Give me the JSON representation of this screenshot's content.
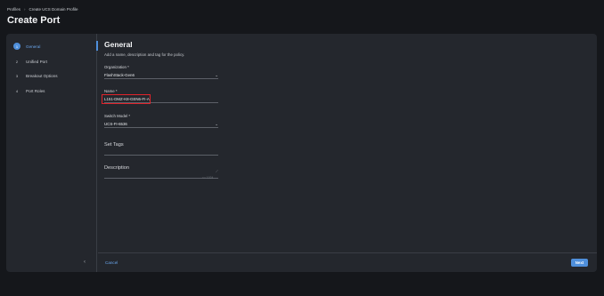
{
  "breadcrumb": {
    "items": [
      "Profiles",
      "Create UCS Domain Profile"
    ],
    "separator": "›"
  },
  "page_title": "Create Port",
  "steps": [
    {
      "num": "1",
      "label": "General",
      "active": true
    },
    {
      "num": "2",
      "label": "Unified Port",
      "active": false
    },
    {
      "num": "3",
      "label": "Breakout Options",
      "active": false
    },
    {
      "num": "4",
      "label": "Port Roles",
      "active": false
    }
  ],
  "collapse_glyph": "‹",
  "section": {
    "title": "General",
    "subtitle": "Add a name, description and tag for the policy."
  },
  "fields": {
    "organization": {
      "label": "Organization *",
      "value": "FlashStack-Gen6"
    },
    "name": {
      "label": "Name *",
      "value": "L151-DMZ-K8-GEN6-FI-A"
    },
    "switch_model": {
      "label": "Switch Model *",
      "value": "UCS-FI-6536"
    },
    "set_tags": {
      "label": "Set Tags"
    },
    "description": {
      "label": "Description",
      "char_count": "<= 1024"
    }
  },
  "chevron_glyph": "⌄",
  "footer": {
    "cancel_label": "Cancel",
    "next_label": "Next"
  },
  "colors": {
    "accent": "#4f8fdb",
    "highlight": "#e0232b",
    "background": "#15171b",
    "card": "#24272d"
  }
}
